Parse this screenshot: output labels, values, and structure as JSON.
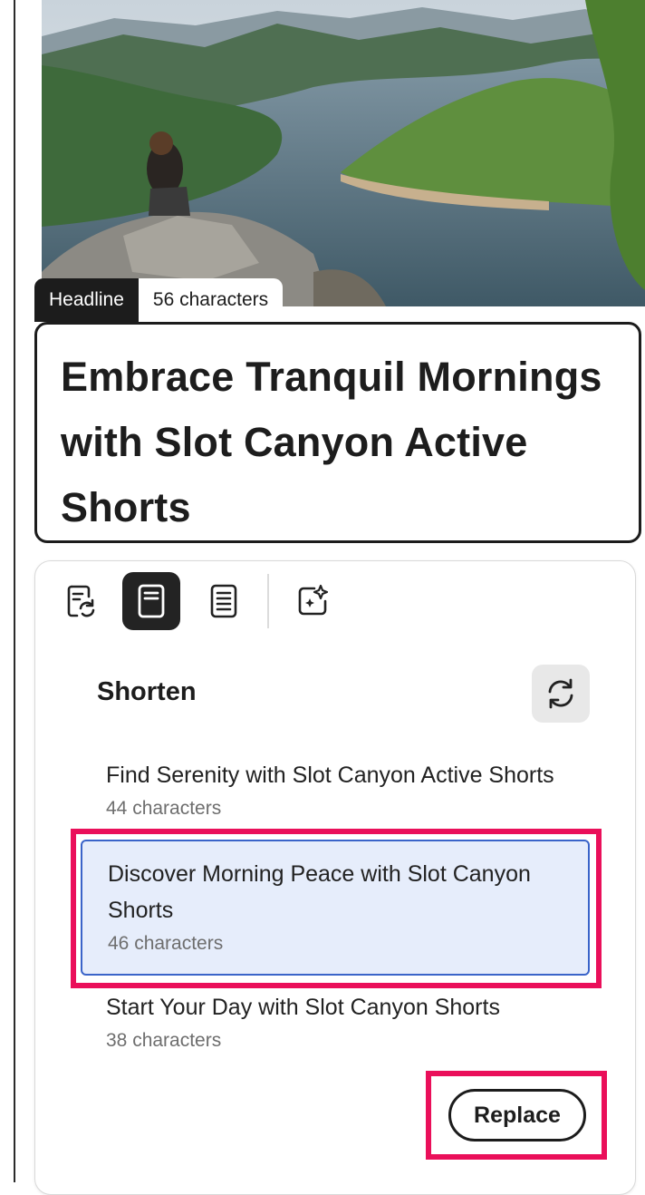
{
  "headline_tag": {
    "label": "Headline",
    "count": "56 characters"
  },
  "headline": {
    "text": "Embrace Tranquil Mornings with Slot Canyon Active Shorts"
  },
  "toolbar": {
    "items": [
      {
        "icon": "rewrite-doc-icon",
        "active": false
      },
      {
        "icon": "shorten-doc-icon",
        "active": true
      },
      {
        "icon": "expand-doc-icon",
        "active": false
      },
      {
        "icon": "ai-sparkle-icon",
        "active": false
      }
    ]
  },
  "panel": {
    "title": "Shorten",
    "refresh_icon": "refresh-icon",
    "options": [
      {
        "text": "Find Serenity with Slot Canyon Active Shorts",
        "count": "44 characters",
        "selected": false
      },
      {
        "text": "Discover Morning Peace with Slot Canyon Shorts",
        "count": "46 characters",
        "selected": true
      },
      {
        "text": "Start Your Day with Slot Canyon Shorts",
        "count": "38 characters",
        "selected": false
      }
    ],
    "replace_label": "Replace"
  },
  "colors": {
    "highlight": "#ea0f5a",
    "selection_bg": "#e6edfb",
    "selection_border": "#3a64c9",
    "dark": "#1c1c1c"
  }
}
